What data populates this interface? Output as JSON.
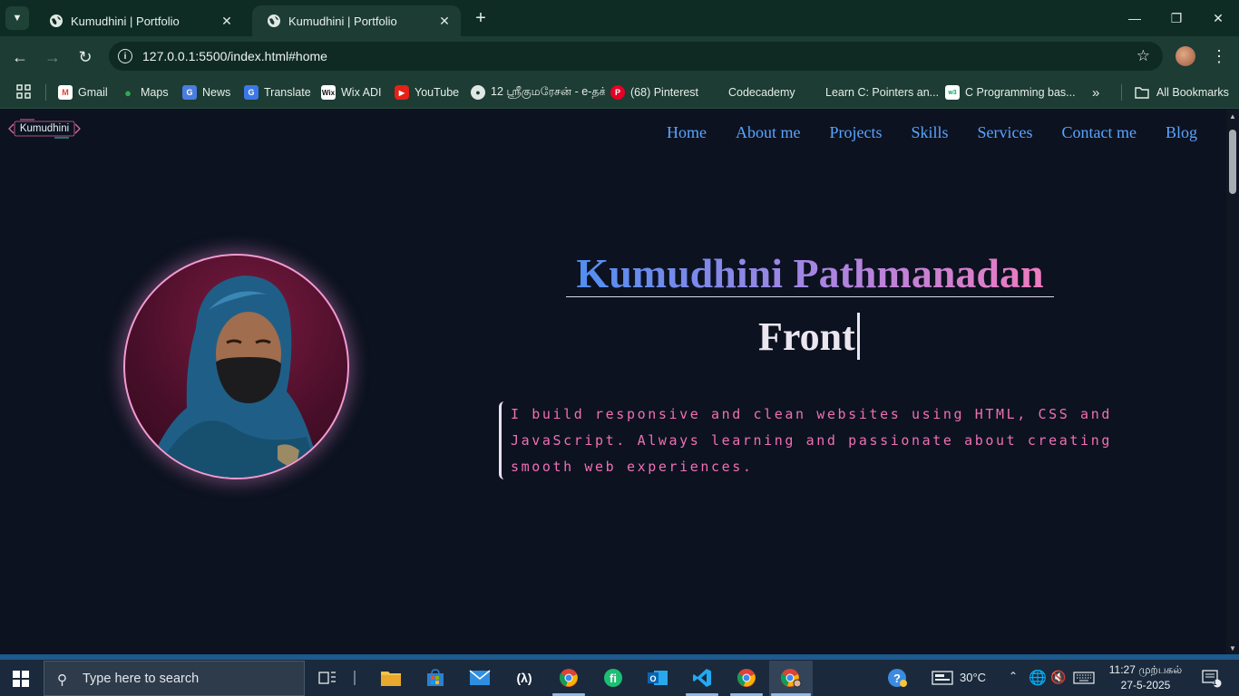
{
  "browser": {
    "tabs": [
      {
        "title": "Kumudhini | Portfolio",
        "active": false
      },
      {
        "title": "Kumudhini | Portfolio",
        "active": true
      }
    ],
    "url": "127.0.0.1:5500/index.html#home",
    "bookmarks": [
      {
        "label": "Gmail",
        "icon": "gmail-icon"
      },
      {
        "label": "Maps",
        "icon": "maps-icon"
      },
      {
        "label": "News",
        "icon": "news-icon"
      },
      {
        "label": "Translate",
        "icon": "translate-icon"
      },
      {
        "label": "Wix ADI",
        "icon": "wix-icon"
      },
      {
        "label": "YouTube",
        "icon": "youtube-icon"
      },
      {
        "label": "12 ஸ்ரீகுமரேசன் - e-தக்...",
        "icon": "globe-icon"
      },
      {
        "label": "(68) Pinterest",
        "icon": "pinterest-icon"
      },
      {
        "label": "Codecademy",
        "icon": "codecademy-icon"
      },
      {
        "label": "Learn C: Pointers an...",
        "icon": "codecademy-icon"
      },
      {
        "label": "C Programming bas...",
        "icon": "w3schools-icon"
      }
    ],
    "all_bookmarks": "All Bookmarks"
  },
  "site": {
    "logo_text": "Kumudhini",
    "nav": [
      "Home",
      "About me",
      "Projects",
      "Skills",
      "Services",
      "Contact me",
      "Blog"
    ],
    "hero": {
      "name": "Kumudhini Pathmanadan",
      "typed_role": "Front",
      "intro_lines": [
        "I build responsive and clean websites using HTML, CSS and",
        "JavaScript. Always learning and passionate about creating",
        "smooth web experiences."
      ]
    },
    "colors": {
      "background": "#0c1220",
      "nav_link": "#5aa4ff",
      "gradient_start": "#4d8ff2",
      "gradient_end": "#f27bbf",
      "intro_text": "#f06fb4"
    }
  },
  "taskbar": {
    "search_placeholder": "Type here to search",
    "weather": "30°C",
    "time": "11:27 முற்பகல்",
    "date": "27-5-2025",
    "notification_count": "1",
    "apps": [
      "task-view-icon",
      "file-explorer-icon",
      "microsoft-store-icon",
      "mail-icon",
      "freecodecamp-icon",
      "chrome-icon",
      "fiverr-icon",
      "outlook-icon",
      "vscode-icon",
      "chrome-icon",
      "chrome-profile-icon"
    ]
  }
}
